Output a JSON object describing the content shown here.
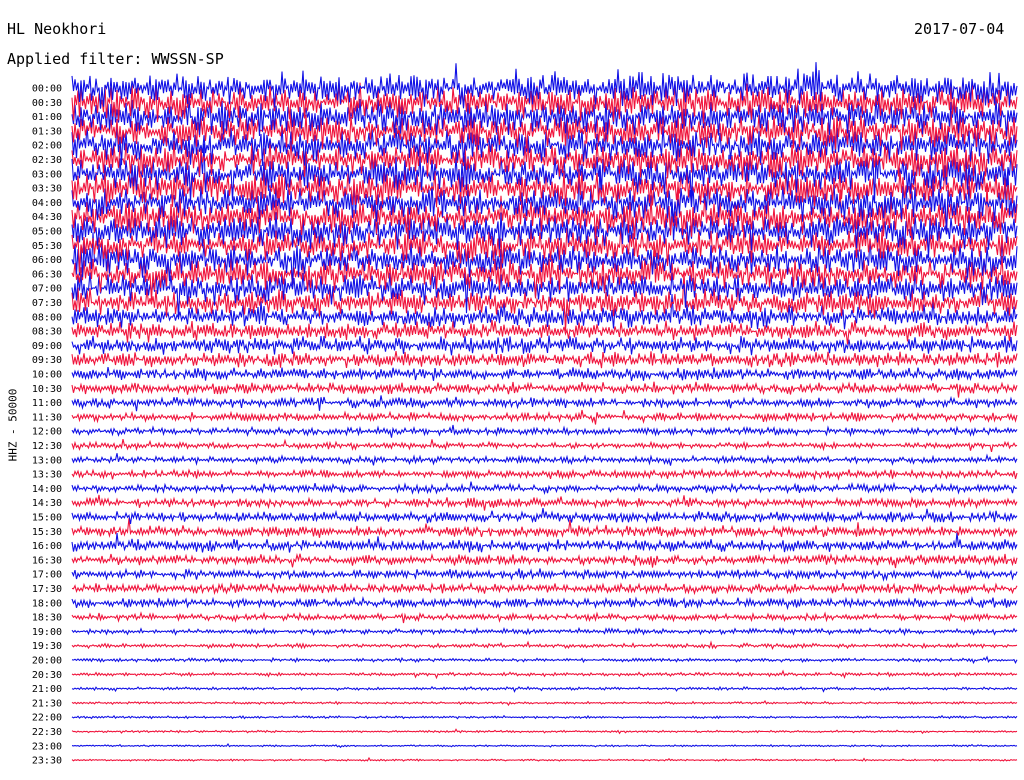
{
  "header": {
    "station": "HL Neokhori",
    "date": "2017-07-04",
    "filter": "Applied filter: WWSSN-SP"
  },
  "chart_data": {
    "type": "helicorder",
    "channel_label": "HHZ - 50000",
    "line_labels": [
      "00:00",
      "00:30",
      "01:00",
      "01:30",
      "02:00",
      "02:30",
      "03:00",
      "03:30",
      "04:00",
      "04:30",
      "05:00",
      "05:30",
      "06:00",
      "06:30",
      "07:00",
      "07:30",
      "08:00",
      "08:30",
      "09:00",
      "09:30",
      "10:00",
      "10:30",
      "11:00",
      "11:30",
      "12:00",
      "12:30",
      "13:00",
      "13:30",
      "14:00",
      "14:30",
      "15:00",
      "15:30",
      "16:00",
      "16:30",
      "17:00",
      "17:30",
      "18:00",
      "18:30",
      "19:00",
      "19:30",
      "20:00",
      "20:30",
      "21:00",
      "21:30",
      "22:00",
      "22:30",
      "23:00",
      "23:30"
    ],
    "minutes_per_line": 30,
    "trace_colors": [
      "#1010e6",
      "#f0143c"
    ],
    "relative_amplitude": [
      3.0,
      3.0,
      3.0,
      3.0,
      3.0,
      3.0,
      3.0,
      3.0,
      3.0,
      3.0,
      2.9,
      2.8,
      2.8,
      2.7,
      2.5,
      2.2,
      1.8,
      1.6,
      1.5,
      1.3,
      1.1,
      0.95,
      0.85,
      0.75,
      0.6,
      0.55,
      0.6,
      0.7,
      0.7,
      0.8,
      0.9,
      0.9,
      1.0,
      0.9,
      0.8,
      0.8,
      0.8,
      0.6,
      0.45,
      0.35,
      0.3,
      0.3,
      0.25,
      0.2,
      0.2,
      0.18,
      0.15,
      0.15
    ]
  }
}
